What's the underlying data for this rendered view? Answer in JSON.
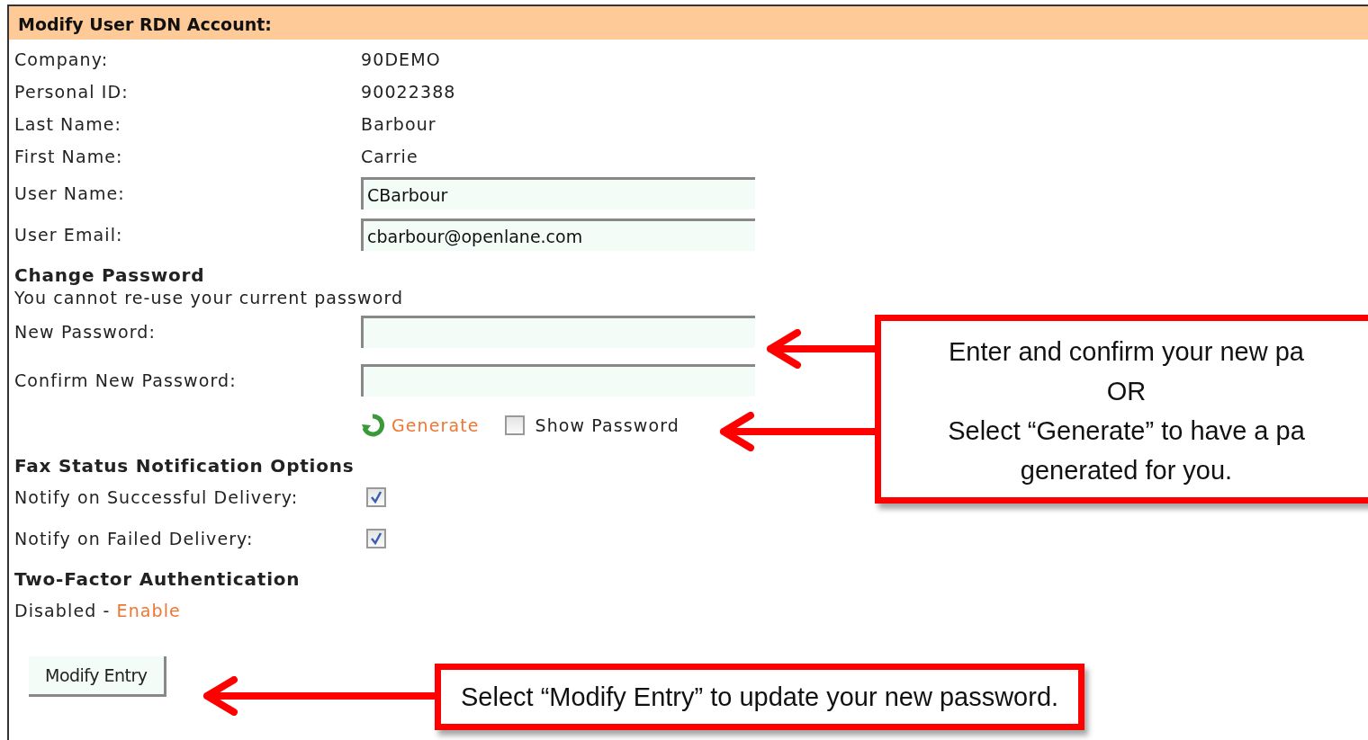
{
  "panel": {
    "title": "Modify User RDN Account:"
  },
  "info_rows": [
    {
      "label": "Company:",
      "value": "90DEMO"
    },
    {
      "label": "Personal ID:",
      "value": "90022388"
    },
    {
      "label": "Last Name:",
      "value": "Barbour"
    },
    {
      "label": "First Name:",
      "value": "Carrie"
    }
  ],
  "fields": [
    {
      "label": "User Name:",
      "value": "CBarbour"
    },
    {
      "label": "User Email:",
      "value": "cbarbour@openlane.com"
    }
  ],
  "change_password": {
    "heading": "Change Password",
    "note": "You cannot re-use your current password",
    "fields": [
      {
        "label": "New Password:"
      },
      {
        "label": "Confirm New Password:"
      }
    ],
    "generate_link": "Generate",
    "show_password": {
      "label": "Show Password",
      "checked": false
    }
  },
  "fax": {
    "heading": "Fax Status Notification Options",
    "options": [
      {
        "label": "Notify on Successful Delivery:",
        "checked": true
      },
      {
        "label": "Notify on Failed Delivery:",
        "checked": true
      }
    ]
  },
  "two_factor": {
    "heading": "Two-Factor Authentication",
    "status": "Disabled",
    "separator": "-",
    "link": "Enable"
  },
  "submit_button": "Modify Entry",
  "callouts": [
    {
      "lines": [
        "Enter and confirm your new pa",
        "OR",
        "Select “Generate” to have a pa",
        "generated for you."
      ]
    },
    {
      "lines": [
        "Select “Modify Entry” to update your new password."
      ]
    }
  ]
}
